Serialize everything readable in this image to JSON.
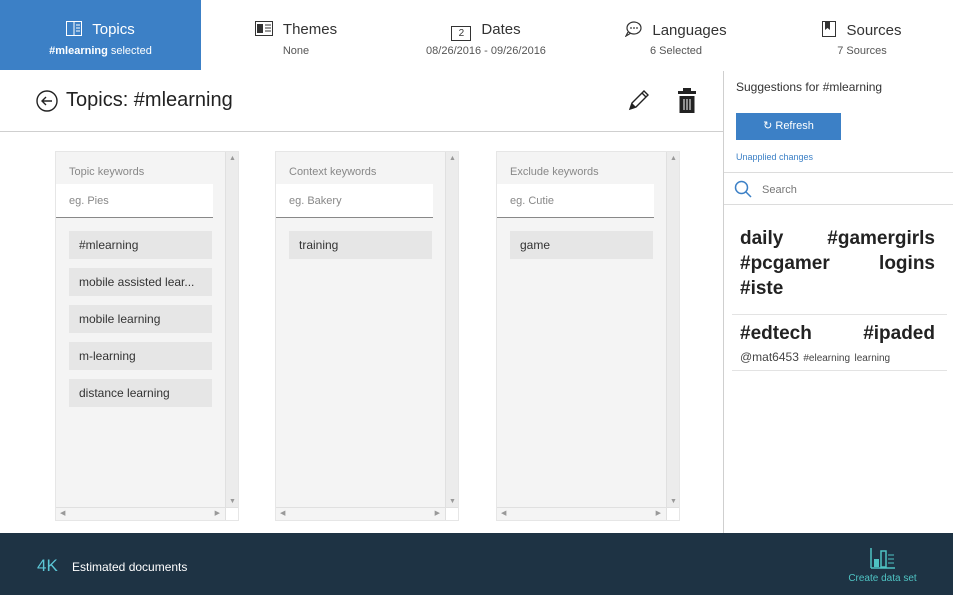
{
  "nav": {
    "tabs": [
      {
        "title": "Topics",
        "sub_bold": "#mlearning",
        "sub": "selected",
        "icon": "book-icon",
        "active": true
      },
      {
        "title": "Themes",
        "sub": "None",
        "icon": "themes-icon"
      },
      {
        "title": "Dates",
        "sub": "08/26/2016 - 09/26/2016",
        "icon": "calendar-icon",
        "icon_text": "2"
      },
      {
        "title": "Languages",
        "sub": "6 Selected",
        "icon": "chat-bubble-icon"
      },
      {
        "title": "Sources",
        "sub": "7 Sources",
        "icon": "bookmark-icon"
      }
    ]
  },
  "main": {
    "title": "Topics: #mlearning",
    "columns": [
      {
        "title": "Topic keywords",
        "placeholder": "eg. Pies",
        "items": [
          "#mlearning",
          "mobile assisted lear...",
          "mobile learning",
          "m-learning",
          "distance learning"
        ]
      },
      {
        "title": "Context keywords",
        "placeholder": "eg. Bakery",
        "items": [
          "training"
        ]
      },
      {
        "title": "Exclude keywords",
        "placeholder": "eg. Cutie",
        "items": [
          "game"
        ]
      }
    ]
  },
  "suggestions": {
    "title": "Suggestions for #mlearning",
    "refresh_label": "Refresh",
    "refresh_icon": "refresh-icon",
    "unapplied": "Unapplied changes",
    "search_placeholder": "Search",
    "cloud1": {
      "line1": [
        "daily",
        "#gamergirls"
      ],
      "line2": [
        "#pcgamer",
        "logins"
      ],
      "line3": [
        "#iste"
      ]
    },
    "cloud2": {
      "line1": [
        "#edtech",
        "#ipaded"
      ],
      "line2": [
        "@mat6453",
        "#elearning",
        "learning"
      ]
    }
  },
  "footer": {
    "estimate_value": "4K",
    "estimate_label": "Estimated documents",
    "create_label": "Create data set",
    "create_icon": "bar-chart-icon"
  },
  "colors": {
    "accent": "#3c80c6",
    "footer_bg": "#1e3344",
    "teal": "#5cc7d6"
  }
}
